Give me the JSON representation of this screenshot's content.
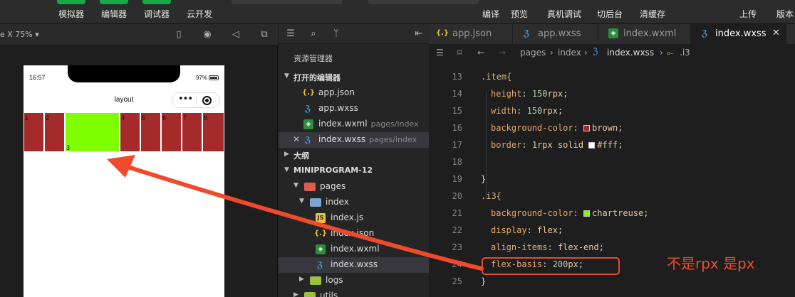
{
  "toolbar": {
    "simulator": "模拟器",
    "editor": "编辑器",
    "debugger": "调试器",
    "cloud": "云开发",
    "compile": "编译",
    "preview": "预览",
    "real_debug": "真机调试",
    "switch_bg": "切后台",
    "clear_cache": "清缓存",
    "upload": "上传",
    "version": "版本"
  },
  "simulator": {
    "device_label": "e X 75% ▾",
    "status_time": "16:57",
    "battery": "97%",
    "nav_title": "layout",
    "capsule_dots": "•••",
    "items": [
      "1",
      "2",
      "3",
      "4",
      "5",
      "6",
      "7",
      "8"
    ],
    "colors": {
      "item": "#a52a2a",
      "i3": "#7fff00"
    }
  },
  "explorer": {
    "title": "资源管理器",
    "open_editors": "打开的编辑器",
    "open_files": [
      {
        "name": "app.json",
        "sub": ""
      },
      {
        "name": "app.wxss",
        "sub": ""
      },
      {
        "name": "index.wxml",
        "sub": "pages/index"
      },
      {
        "name": "index.wxss",
        "sub": "pages/index"
      }
    ],
    "outline": "大纲",
    "project": "MINIPROGRAM-12",
    "tree": {
      "pages": "pages",
      "index": "index",
      "files": [
        "index.js",
        "index.json",
        "index.wxml",
        "index.wxss"
      ],
      "logs": "logs",
      "utils": "utils"
    }
  },
  "editor": {
    "tabs": [
      "app.json",
      "app.wxss",
      "index.wxml",
      "index.wxss"
    ],
    "breadcrumb": [
      "pages",
      "index",
      "index.wxss",
      ".i3"
    ],
    "lines": [
      {
        "n": "13",
        "sel": ".item{"
      },
      {
        "n": "14",
        "prop": "height",
        "num": "150",
        "unit": "rpx"
      },
      {
        "n": "15",
        "prop": "width",
        "num": "150",
        "unit": "rpx"
      },
      {
        "n": "16",
        "prop": "background-color",
        "val": "brown",
        "swatch": "#a52a2a"
      },
      {
        "n": "17",
        "prop": "border",
        "num": "1",
        "unit": "rpx",
        "val": " solid ",
        "val2": "#fff",
        "swatch": "#ffffff"
      },
      {
        "n": "18"
      },
      {
        "n": "19",
        "sel": "}"
      },
      {
        "n": "20",
        "sel": ".i3{"
      },
      {
        "n": "21",
        "prop": "background-color",
        "val": "chartreuse",
        "swatch": "#7fff00"
      },
      {
        "n": "22",
        "prop": "display",
        "val": "flex"
      },
      {
        "n": "23",
        "prop": "align-items",
        "val": "flex-end"
      },
      {
        "n": "24",
        "prop": "flex-basis",
        "num": "200",
        "unit": "px"
      },
      {
        "n": "25",
        "sel": "}"
      }
    ]
  },
  "annotation": "不是rpx 是px",
  "accent_color": "#e64a2e"
}
